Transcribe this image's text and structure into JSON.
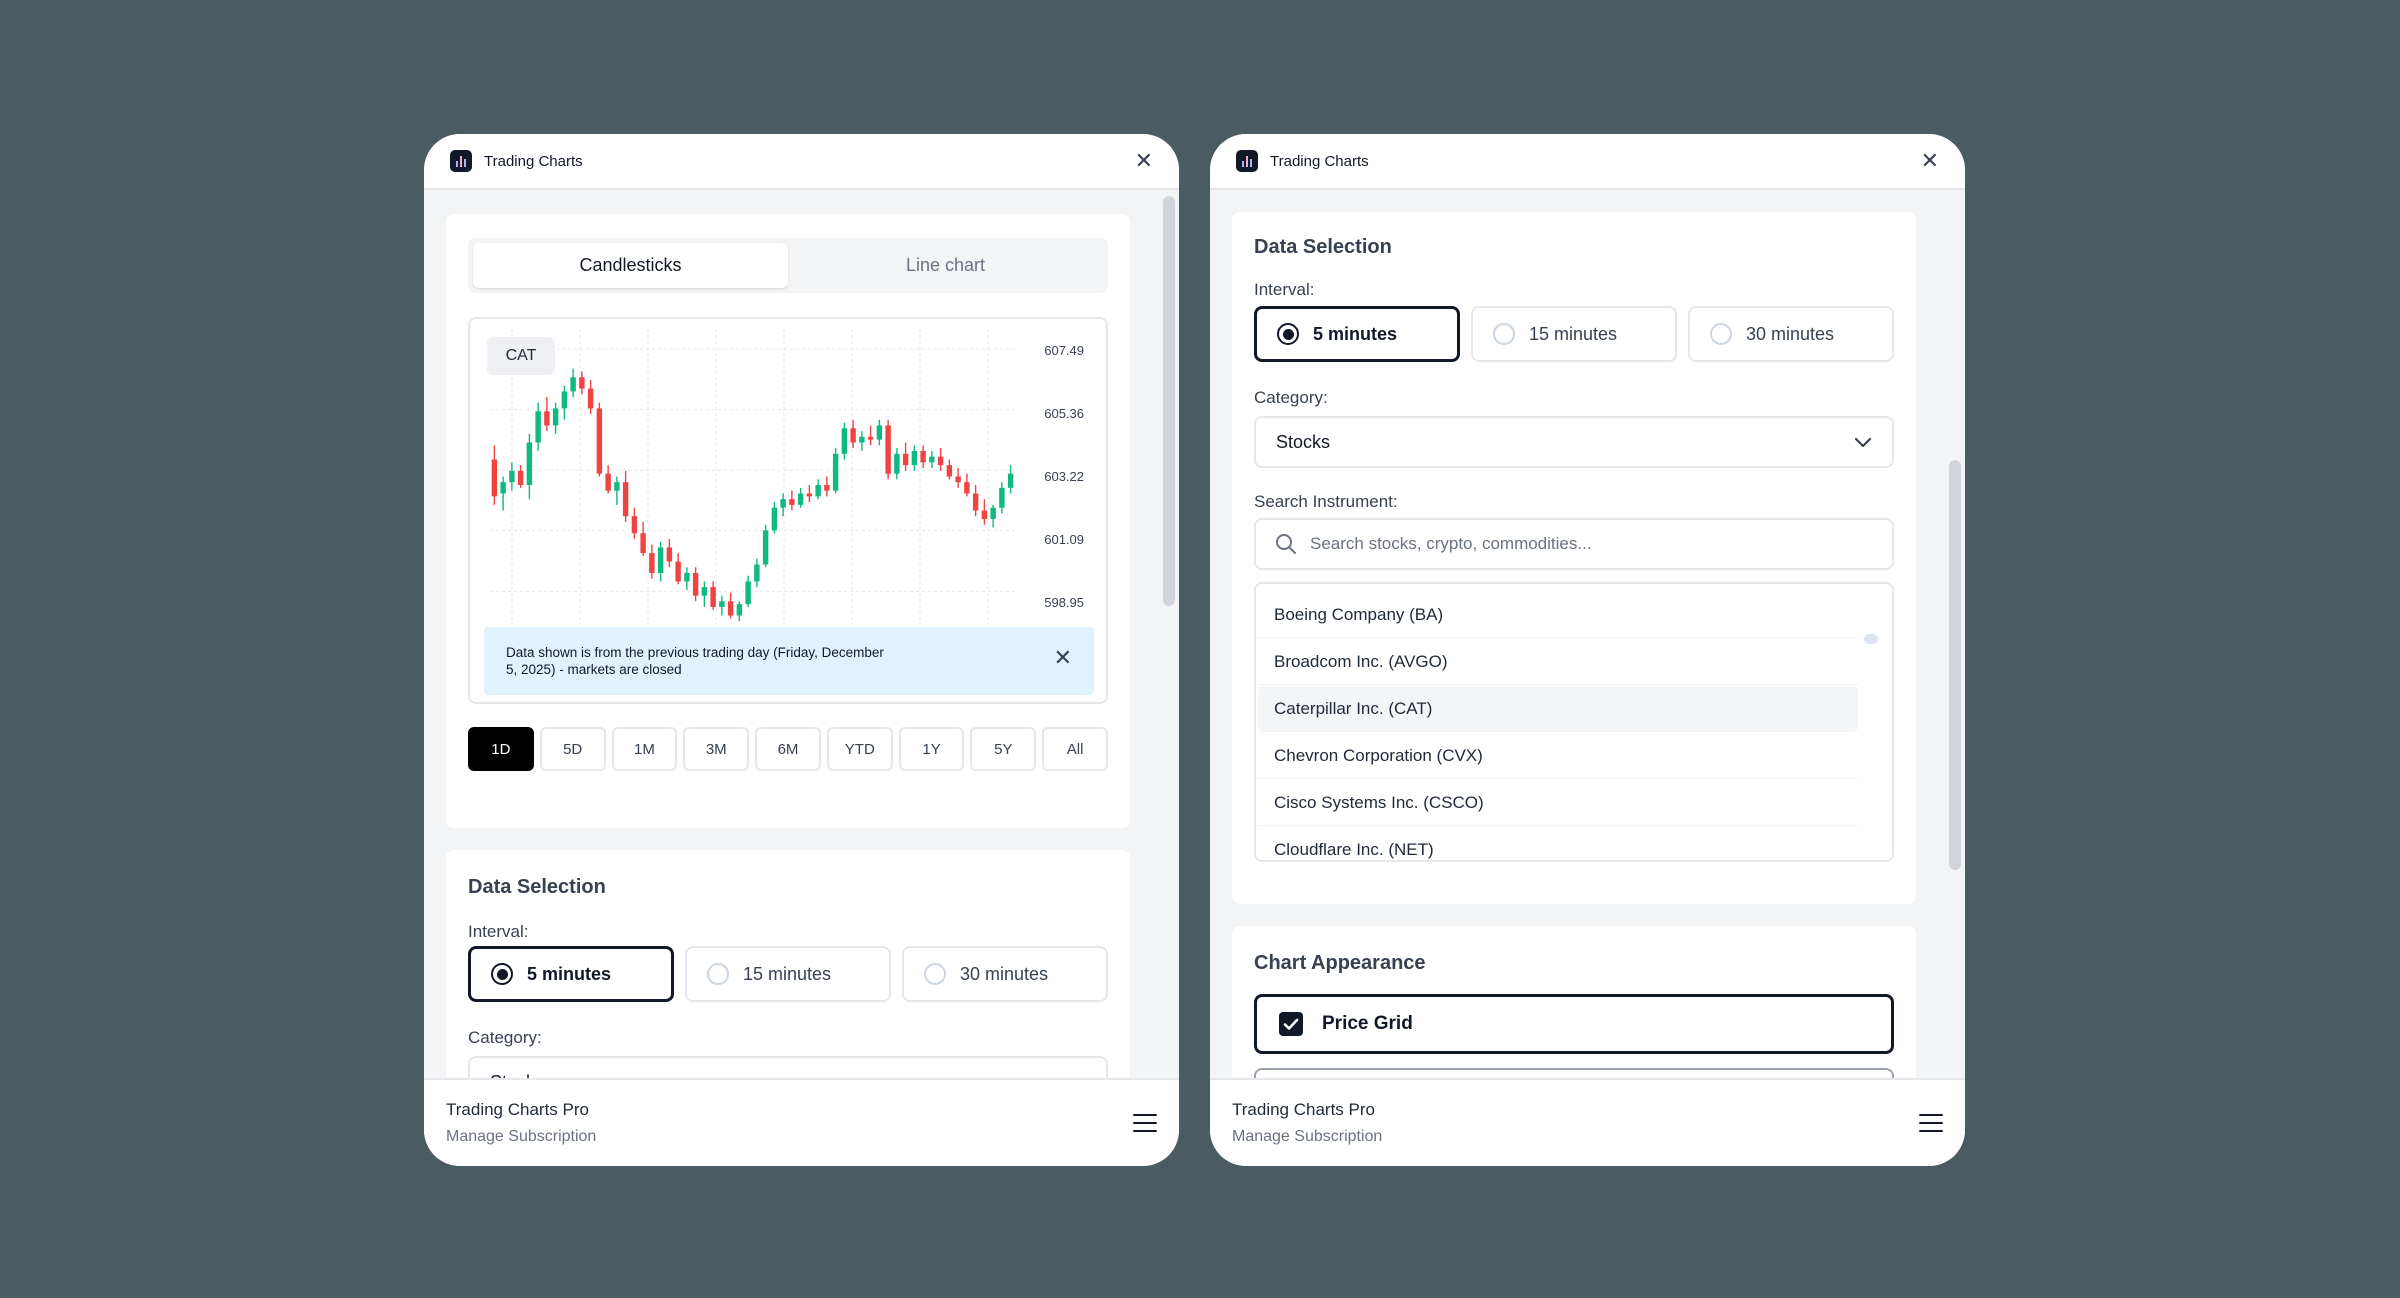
{
  "app": {
    "title": "Trading Charts",
    "footer_brand": "Trading Charts Pro",
    "footer_link": "Manage Subscription"
  },
  "chart_tabs": [
    {
      "label": "Candlesticks",
      "active": true
    },
    {
      "label": "Line chart",
      "active": false
    }
  ],
  "chart": {
    "ticker": "CAT",
    "price_labels": [
      "607.49",
      "605.36",
      "603.22",
      "601.09",
      "598.95"
    ],
    "notice": "Data shown is from the previous trading day (Friday, December 5, 2025) - markets are closed"
  },
  "ranges": [
    {
      "label": "1D",
      "active": true
    },
    {
      "label": "5D",
      "active": false
    },
    {
      "label": "1M",
      "active": false
    },
    {
      "label": "3M",
      "active": false
    },
    {
      "label": "6M",
      "active": false
    },
    {
      "label": "YTD",
      "active": false
    },
    {
      "label": "1Y",
      "active": false
    },
    {
      "label": "5Y",
      "active": false
    },
    {
      "label": "All",
      "active": false
    }
  ],
  "data_selection": {
    "title": "Data Selection",
    "interval_label": "Interval:",
    "intervals": [
      {
        "label": "5 minutes",
        "selected": true
      },
      {
        "label": "15 minutes",
        "selected": false
      },
      {
        "label": "30 minutes",
        "selected": false
      }
    ],
    "category_label": "Category:",
    "category_value": "Stocks",
    "search_label": "Search Instrument:",
    "search_placeholder": "Search stocks, crypto, commodities...",
    "instruments": [
      "Boeing Company (BA)",
      "Broadcom Inc. (AVGO)",
      "Caterpillar Inc. (CAT)",
      "Chevron Corporation (CVX)",
      "Cisco Systems Inc. (CSCO)",
      "Cloudflare Inc. (NET)"
    ],
    "hovered_instrument": "Caterpillar Inc. (CAT)"
  },
  "appearance": {
    "title": "Chart Appearance",
    "price_grid_label": "Price Grid",
    "price_grid_checked": true
  },
  "chart_data": {
    "type": "candlestick",
    "title": "CAT",
    "ylim": [
      597.8,
      608.2
    ],
    "y_ticks": [
      607.49,
      605.36,
      603.22,
      601.09,
      598.95
    ],
    "candles": [
      [
        603.6,
        604.1,
        602.0,
        602.3
      ],
      [
        602.4,
        603.0,
        601.8,
        602.8
      ],
      [
        602.8,
        603.5,
        602.5,
        603.2
      ],
      [
        603.2,
        603.4,
        602.6,
        602.7
      ],
      [
        602.7,
        604.5,
        602.2,
        604.2
      ],
      [
        604.2,
        605.6,
        603.9,
        605.3
      ],
      [
        605.3,
        605.8,
        604.6,
        604.8
      ],
      [
        604.8,
        605.6,
        604.5,
        605.4
      ],
      [
        605.4,
        606.2,
        605.0,
        606.0
      ],
      [
        606.0,
        606.8,
        605.8,
        606.5
      ],
      [
        606.5,
        606.7,
        605.9,
        606.1
      ],
      [
        606.1,
        606.4,
        605.2,
        605.4
      ],
      [
        605.4,
        605.6,
        603.0,
        603.1
      ],
      [
        603.1,
        603.4,
        602.4,
        602.5
      ],
      [
        602.5,
        603.0,
        602.0,
        602.8
      ],
      [
        602.8,
        603.2,
        601.4,
        601.6
      ],
      [
        601.6,
        601.9,
        600.8,
        601.0
      ],
      [
        601.0,
        601.4,
        600.2,
        600.3
      ],
      [
        600.3,
        600.6,
        599.4,
        599.6
      ],
      [
        599.6,
        600.7,
        599.3,
        600.5
      ],
      [
        600.5,
        600.8,
        599.8,
        600.0
      ],
      [
        600.0,
        600.3,
        599.2,
        599.3
      ],
      [
        599.3,
        599.8,
        599.0,
        599.6
      ],
      [
        599.6,
        599.8,
        598.6,
        598.8
      ],
      [
        598.8,
        599.3,
        598.4,
        599.1
      ],
      [
        599.1,
        599.3,
        598.3,
        598.4
      ],
      [
        598.4,
        598.8,
        598.1,
        598.6
      ],
      [
        598.6,
        598.9,
        598.0,
        598.1
      ],
      [
        598.1,
        598.6,
        597.9,
        598.5
      ],
      [
        598.5,
        599.5,
        598.4,
        599.3
      ],
      [
        599.3,
        600.1,
        599.1,
        599.9
      ],
      [
        599.9,
        601.3,
        599.8,
        601.1
      ],
      [
        601.1,
        602.1,
        601.0,
        601.9
      ],
      [
        601.9,
        602.4,
        601.6,
        602.2
      ],
      [
        602.2,
        602.5,
        601.8,
        602.0
      ],
      [
        602.0,
        602.6,
        601.9,
        602.4
      ],
      [
        602.4,
        602.7,
        602.1,
        602.3
      ],
      [
        602.3,
        602.9,
        602.2,
        602.7
      ],
      [
        602.7,
        603.0,
        602.3,
        602.5
      ],
      [
        602.5,
        604.0,
        602.4,
        603.8
      ],
      [
        603.8,
        604.9,
        603.6,
        604.7
      ],
      [
        604.7,
        605.0,
        604.0,
        604.2
      ],
      [
        604.2,
        604.6,
        603.9,
        604.4
      ],
      [
        604.4,
        604.8,
        604.1,
        604.3
      ],
      [
        604.3,
        605.0,
        604.1,
        604.8
      ],
      [
        604.8,
        605.0,
        602.9,
        603.1
      ],
      [
        603.1,
        604.0,
        602.9,
        603.8
      ],
      [
        603.8,
        604.2,
        603.2,
        603.4
      ],
      [
        603.4,
        604.1,
        603.2,
        603.9
      ],
      [
        603.9,
        604.1,
        603.3,
        603.5
      ],
      [
        603.5,
        603.9,
        603.3,
        603.7
      ],
      [
        603.7,
        604.0,
        603.2,
        603.4
      ],
      [
        603.4,
        603.6,
        602.9,
        603.0
      ],
      [
        603.0,
        603.3,
        602.6,
        602.8
      ],
      [
        602.8,
        603.1,
        602.3,
        602.4
      ],
      [
        602.4,
        602.7,
        601.6,
        601.8
      ],
      [
        601.8,
        602.2,
        601.3,
        601.5
      ],
      [
        601.5,
        602.0,
        601.2,
        601.9
      ],
      [
        601.9,
        602.8,
        601.7,
        602.6
      ],
      [
        602.6,
        603.4,
        602.4,
        603.1
      ]
    ]
  }
}
